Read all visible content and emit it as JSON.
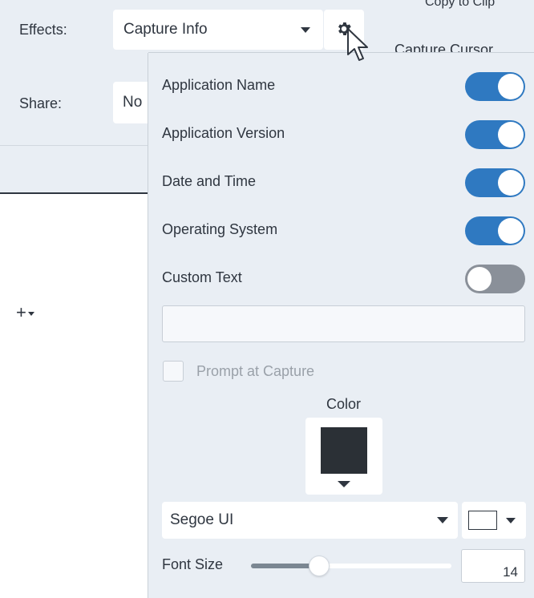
{
  "effects": {
    "label": "Effects:",
    "selected": "Capture Info"
  },
  "share": {
    "label": "Share:",
    "selected": "No"
  },
  "capture_cursor_text": "Capture Cursor",
  "top_cut_text": "Copy to Clip",
  "toolbar": {
    "add_label": "+"
  },
  "popup": {
    "toggles": [
      {
        "label": "Application Name",
        "on": true
      },
      {
        "label": "Application Version",
        "on": true
      },
      {
        "label": "Date and Time",
        "on": true
      },
      {
        "label": "Operating System",
        "on": true
      },
      {
        "label": "Custom Text",
        "on": false
      }
    ],
    "custom_text_value": "",
    "prompt_label": "Prompt at Capture",
    "prompt_checked": false,
    "color_label": "Color",
    "text_color": "#2b3036",
    "font_name": "Segoe UI",
    "font_color": "#ffffff",
    "font_size_label": "Font Size",
    "font_size_value": "14",
    "font_size_fraction": 0.34
  },
  "colors": {
    "accent": "#2f79c1",
    "panel": "#e9eef4",
    "toggle_off": "#8a9099"
  },
  "icons": {
    "gear": "gear-icon",
    "cursor": "mouse-pointer-icon"
  }
}
